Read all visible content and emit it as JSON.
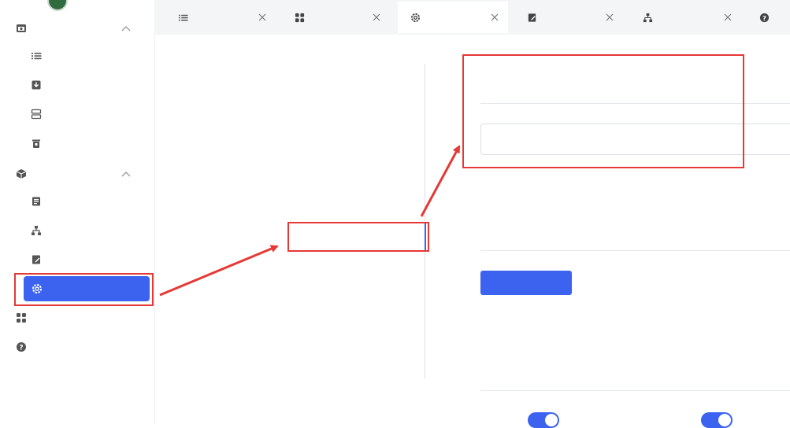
{
  "colors": {
    "accent": "#3b63f0",
    "annotation": "#e53935",
    "text": "#333333"
  },
  "sidebar": {
    "avatar_icon": "avatar",
    "groups": [
      {
        "label": "",
        "icon": "browser-icon",
        "expanded": true,
        "items": [
          {
            "label": "",
            "icon": "list-icon"
          },
          {
            "label": "",
            "icon": "download-share-icon"
          },
          {
            "label": "",
            "icon": "group-icon"
          },
          {
            "label": "",
            "icon": "trash-icon"
          }
        ]
      },
      {
        "label": "",
        "icon": "cube-account-icon",
        "expanded": true,
        "items": [
          {
            "label": "",
            "icon": "package-icon"
          },
          {
            "label": "",
            "icon": "org-tree-icon"
          },
          {
            "label": "",
            "icon": "log-icon"
          },
          {
            "label": "",
            "icon": "gear-icon",
            "active": true
          }
        ]
      },
      {
        "label": "",
        "icon": "apps-icon"
      },
      {
        "label": "",
        "icon": "help-icon"
      }
    ]
  },
  "tabs": [
    {
      "label": "",
      "icon": "list-icon"
    },
    {
      "label": "",
      "icon": "apps-icon"
    },
    {
      "label": "",
      "icon": "gear-icon",
      "active": true
    },
    {
      "label": "",
      "icon": "log-icon"
    },
    {
      "label": "",
      "icon": "org-tree-icon"
    },
    {
      "label": "",
      "icon": "help-icon"
    }
  ],
  "content_nav": [
    {
      "label": ""
    },
    {
      "label": ""
    },
    {
      "label": ""
    },
    {
      "label": ""
    },
    {
      "label": ""
    },
    {
      "label": "",
      "active": true
    },
    {
      "label": ""
    },
    {
      "label": ""
    },
    {
      "label": ""
    },
    {
      "label": ""
    }
  ],
  "sections": {
    "custom_args": {
      "title": "",
      "input_value": "",
      "input_placeholder": ""
    },
    "proxy": {
      "title": "",
      "button_label": ""
    },
    "sync": {
      "title": "",
      "toggles": [
        {
          "label": "",
          "on": true
        },
        {
          "label": "",
          "on": true
        }
      ]
    }
  }
}
